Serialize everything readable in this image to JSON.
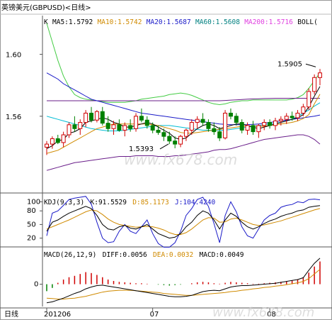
{
  "window": {
    "title": "英镑美元(GBPUSD)<日线>"
  },
  "main_panel": {
    "label": "K",
    "indicators": [
      {
        "text": "MA5:1.5792",
        "color": "#000000"
      },
      {
        "text": "MA10:1.5742",
        "color": "#d08a00"
      },
      {
        "text": "MA20:1.5687",
        "color": "#1a1ac8"
      },
      {
        "text": "MA60:1.5608",
        "color": "#008080"
      },
      {
        "text": "MA200:1.5716",
        "color": "#e040e0"
      },
      {
        "text": "BOLL(",
        "color": "#000000"
      }
    ],
    "y_ticks": [
      "1.60",
      "1.56"
    ],
    "annotations": {
      "high": "1.5905",
      "low": "1.5393"
    }
  },
  "kdj_panel": {
    "label": "KDJ(9,3,3)",
    "values": [
      {
        "text": "K:91.5529",
        "color": "#000000"
      },
      {
        "text": "D:85.1173",
        "color": "#d08a00"
      },
      {
        "text": "J:104.4240",
        "color": "#1a1ac8"
      }
    ],
    "y_ticks": [
      "100",
      "80",
      "50",
      "20"
    ]
  },
  "macd_panel": {
    "label": "MACD(26,12,9)",
    "values": [
      {
        "text": "DIFF:0.0056",
        "color": "#000000"
      },
      {
        "text": "DEA:0.0032",
        "color": "#d08a00"
      },
      {
        "text": "MACD:0.0049",
        "color": "#000000"
      }
    ],
    "y_ticks": [
      "0"
    ]
  },
  "x_axis": {
    "period_label": "日线",
    "ticks": [
      "201206",
      "07",
      "08"
    ]
  },
  "watermark": "www.fx678.com",
  "colors": {
    "up": "#d00000",
    "down": "#008000",
    "k": "#000000",
    "d": "#d08a00",
    "j": "#1a1ac8"
  },
  "chart_data": {
    "type": "candlestick",
    "series": [
      {
        "type": "candlestick",
        "values": [
          [
            1.54,
            1.544,
            1.535,
            1.542
          ],
          [
            1.542,
            1.547,
            1.539,
            1.5455
          ],
          [
            1.5455,
            1.548,
            1.542,
            1.543
          ],
          [
            1.543,
            1.55,
            1.54,
            1.548
          ],
          [
            1.548,
            1.556,
            1.546,
            1.5545
          ],
          [
            1.5545,
            1.56,
            1.55,
            1.552
          ],
          [
            1.552,
            1.558,
            1.548,
            1.556
          ],
          [
            1.556,
            1.564,
            1.553,
            1.562
          ],
          [
            1.562,
            1.566,
            1.556,
            1.5575
          ],
          [
            1.5575,
            1.564,
            1.556,
            1.563
          ],
          [
            1.563,
            1.566,
            1.554,
            1.5555
          ],
          [
            1.5555,
            1.56,
            1.55,
            1.552
          ],
          [
            1.552,
            1.557,
            1.548,
            1.5545
          ],
          [
            1.5545,
            1.558,
            1.55,
            1.551
          ],
          [
            1.551,
            1.556,
            1.547,
            1.554
          ],
          [
            1.554,
            1.558,
            1.55,
            1.552
          ],
          [
            1.552,
            1.562,
            1.55,
            1.56
          ],
          [
            1.56,
            1.565,
            1.556,
            1.5575
          ],
          [
            1.5575,
            1.56,
            1.552,
            1.554
          ],
          [
            1.554,
            1.556,
            1.549,
            1.551
          ],
          [
            1.551,
            1.554,
            1.548,
            1.5495
          ],
          [
            1.5495,
            1.552,
            1.544,
            1.547
          ],
          [
            1.547,
            1.55,
            1.542,
            1.544
          ],
          [
            1.544,
            1.547,
            1.5393,
            1.542
          ],
          [
            1.542,
            1.548,
            1.54,
            1.547
          ],
          [
            1.547,
            1.552,
            1.544,
            1.551
          ],
          [
            1.551,
            1.558,
            1.548,
            1.556
          ],
          [
            1.556,
            1.56,
            1.552,
            1.558
          ],
          [
            1.558,
            1.562,
            1.554,
            1.556
          ],
          [
            1.556,
            1.558,
            1.55,
            1.552
          ],
          [
            1.552,
            1.556,
            1.548,
            1.55
          ],
          [
            1.55,
            1.553,
            1.544,
            1.546
          ],
          [
            1.546,
            1.564,
            1.545,
            1.562
          ],
          [
            1.562,
            1.565,
            1.558,
            1.56
          ],
          [
            1.56,
            1.562,
            1.554,
            1.556
          ],
          [
            1.556,
            1.558,
            1.549,
            1.551
          ],
          [
            1.551,
            1.556,
            1.548,
            1.554
          ],
          [
            1.554,
            1.557,
            1.548,
            1.55
          ],
          [
            1.55,
            1.555,
            1.546,
            1.554
          ],
          [
            1.554,
            1.558,
            1.551,
            1.556
          ],
          [
            1.556,
            1.558,
            1.552,
            1.554
          ],
          [
            1.554,
            1.559,
            1.551,
            1.557
          ],
          [
            1.557,
            1.56,
            1.554,
            1.558
          ],
          [
            1.558,
            1.562,
            1.555,
            1.56
          ],
          [
            1.56,
            1.563,
            1.557,
            1.559
          ],
          [
            1.559,
            1.564,
            1.557,
            1.562
          ],
          [
            1.562,
            1.568,
            1.56,
            1.566
          ],
          [
            1.566,
            1.578,
            1.564,
            1.576
          ],
          [
            1.576,
            1.587,
            1.574,
            1.585
          ],
          [
            1.585,
            1.5905,
            1.58,
            1.588
          ]
        ]
      },
      {
        "name": "MA5",
        "values": [
          1.539,
          1.541,
          1.544,
          1.545,
          1.549,
          1.55,
          1.552,
          1.556,
          1.557,
          1.558,
          1.559,
          1.558,
          1.556,
          1.555,
          1.553,
          1.553,
          1.554,
          1.555,
          1.556,
          1.555,
          1.553,
          1.551,
          1.549,
          1.546,
          1.545,
          1.546,
          1.549,
          1.552,
          1.554,
          1.555,
          1.554,
          1.552,
          1.553,
          1.554,
          1.555,
          1.555,
          1.554,
          1.553,
          1.552,
          1.553,
          1.554,
          1.555,
          1.556,
          1.557,
          1.558,
          1.559,
          1.561,
          1.566,
          1.573,
          1.5792
        ]
      },
      {
        "name": "MA10",
        "values": [
          1.536,
          1.537,
          1.538,
          1.54,
          1.542,
          1.544,
          1.546,
          1.548,
          1.55,
          1.552,
          1.553,
          1.554,
          1.555,
          1.555,
          1.555,
          1.555,
          1.555,
          1.555,
          1.555,
          1.5545,
          1.554,
          1.553,
          1.552,
          1.551,
          1.5495,
          1.549,
          1.549,
          1.5495,
          1.55,
          1.5505,
          1.551,
          1.5515,
          1.552,
          1.5525,
          1.553,
          1.5535,
          1.5535,
          1.5535,
          1.5535,
          1.5535,
          1.554,
          1.5545,
          1.555,
          1.5555,
          1.556,
          1.557,
          1.5585,
          1.561,
          1.568,
          1.5742
        ]
      },
      {
        "name": "MA20",
        "values": [
          1.56,
          1.559,
          1.558,
          1.557,
          1.556,
          1.555,
          1.554,
          1.553,
          1.552,
          1.5515,
          1.551,
          1.5505,
          1.5505,
          1.5505,
          1.551,
          1.5515,
          1.552,
          1.5525,
          1.553,
          1.5535,
          1.554,
          1.554,
          1.554,
          1.5535,
          1.553,
          1.5525,
          1.552,
          1.5515,
          1.551,
          1.551,
          1.551,
          1.551,
          1.551,
          1.5515,
          1.552,
          1.5525,
          1.553,
          1.5535,
          1.554,
          1.5545,
          1.555,
          1.5555,
          1.556,
          1.557,
          1.558,
          1.56,
          1.562,
          1.564,
          1.5665,
          1.5687
        ]
      },
      {
        "name": "MA60",
        "values": [
          1.588,
          1.586,
          1.584,
          1.581,
          1.579,
          1.577,
          1.575,
          1.573,
          1.571,
          1.57,
          1.569,
          1.568,
          1.567,
          1.566,
          1.565,
          1.564,
          1.563,
          1.562,
          1.5615,
          1.561,
          1.5605,
          1.56,
          1.5595,
          1.559,
          1.5585,
          1.558,
          1.5575,
          1.557,
          1.5565,
          1.556,
          1.5555,
          1.555,
          1.5548,
          1.5546,
          1.5545,
          1.5545,
          1.5546,
          1.5548,
          1.555,
          1.5555,
          1.556,
          1.5565,
          1.557,
          1.5575,
          1.558,
          1.5585,
          1.559,
          1.5595,
          1.56,
          1.5608
        ]
      },
      {
        "name": "MA200",
        "values": [
          1.57,
          1.57,
          1.57,
          1.57,
          1.57,
          1.57,
          1.57,
          1.57,
          1.57,
          1.57,
          1.57,
          1.57,
          1.57,
          1.57,
          1.57,
          1.57,
          1.57,
          1.57,
          1.57,
          1.57,
          1.57,
          1.57,
          1.57,
          1.57,
          1.57,
          1.57,
          1.57,
          1.57,
          1.57,
          1.57,
          1.57,
          1.57,
          1.5702,
          1.5704,
          1.5706,
          1.5708,
          1.571,
          1.5712,
          1.5713,
          1.5714,
          1.5715,
          1.5716,
          1.5716,
          1.5716,
          1.5716,
          1.5716,
          1.5716,
          1.5716,
          1.5716,
          1.5716
        ]
      },
      {
        "name": "BOLL-UP",
        "values": [
          1.62,
          1.608,
          1.596,
          1.586,
          1.579,
          1.574,
          1.572,
          1.571,
          1.5705,
          1.57,
          1.5695,
          1.569,
          1.569,
          1.569,
          1.569,
          1.5695,
          1.57,
          1.571,
          1.5715,
          1.572,
          1.5725,
          1.573,
          1.574,
          1.5745,
          1.575,
          1.5745,
          1.5735,
          1.572,
          1.5705,
          1.569,
          1.568,
          1.5675,
          1.568,
          1.569,
          1.5695,
          1.57,
          1.57,
          1.5705,
          1.5705,
          1.5705,
          1.5705,
          1.5705,
          1.5705,
          1.5705,
          1.571,
          1.572,
          1.574,
          1.578,
          1.583,
          1.588
        ]
      },
      {
        "name": "BOLL-LOW",
        "values": [
          1.525,
          1.526,
          1.527,
          1.528,
          1.529,
          1.53,
          1.5305,
          1.531,
          1.5315,
          1.532,
          1.5325,
          1.533,
          1.5335,
          1.534,
          1.534,
          1.534,
          1.5345,
          1.5345,
          1.5345,
          1.5345,
          1.534,
          1.534,
          1.534,
          1.5345,
          1.5345,
          1.535,
          1.5355,
          1.536,
          1.5365,
          1.537,
          1.538,
          1.5385,
          1.5385,
          1.539,
          1.54,
          1.541,
          1.542,
          1.543,
          1.544,
          1.545,
          1.5455,
          1.546,
          1.5465,
          1.547,
          1.5475,
          1.548,
          1.548,
          1.547,
          1.545,
          1.542
        ]
      },
      {
        "name": "K",
        "values": [
          35,
          55,
          60,
          68,
          75,
          80,
          85,
          90,
          85,
          70,
          50,
          40,
          38,
          45,
          48,
          42,
          40,
          45,
          50,
          40,
          30,
          25,
          20,
          22,
          30,
          45,
          55,
          70,
          80,
          75,
          60,
          40,
          60,
          75,
          68,
          55,
          45,
          40,
          45,
          52,
          58,
          62,
          68,
          72,
          75,
          80,
          82,
          88,
          90,
          91.55
        ]
      },
      {
        "name": "D",
        "values": [
          40,
          45,
          50,
          55,
          60,
          66,
          72,
          78,
          82,
          80,
          72,
          62,
          55,
          50,
          48,
          46,
          44,
          45,
          46,
          45,
          42,
          38,
          32,
          28,
          28,
          32,
          40,
          50,
          60,
          65,
          64,
          55,
          56,
          62,
          64,
          60,
          55,
          50,
          48,
          49,
          52,
          55,
          58,
          62,
          66,
          70,
          74,
          78,
          82,
          85.12
        ]
      },
      {
        "name": "J",
        "values": [
          25,
          75,
          80,
          92,
          105,
          108,
          110,
          112,
          95,
          55,
          20,
          10,
          12,
          35,
          50,
          35,
          30,
          45,
          60,
          30,
          8,
          0,
          0,
          10,
          35,
          70,
          85,
          105,
          110,
          90,
          52,
          10,
          70,
          100,
          78,
          45,
          25,
          20,
          40,
          60,
          70,
          75,
          88,
          92,
          94,
          100,
          98,
          105,
          106,
          104.42
        ]
      },
      {
        "name": "MACD",
        "values": [
          -0.0015,
          -0.0008,
          0.0003,
          0.001,
          0.0015,
          0.0018,
          0.0022,
          0.0026,
          0.0024,
          0.002,
          0.0015,
          0.001,
          0.0007,
          0.0005,
          0.0004,
          0.0003,
          0.0002,
          0.0002,
          0.0001,
          0.0,
          -0.0001,
          -0.0002,
          -0.0003,
          -0.0002,
          -0.0001,
          0.0,
          0.0002,
          0.0004,
          0.0005,
          0.0004,
          0.0002,
          0.0001,
          0.0003,
          0.0005,
          0.0004,
          0.0003,
          0.0002,
          0.0001,
          0.0001,
          0.0002,
          0.0003,
          0.0004,
          0.0005,
          0.0006,
          0.0008,
          0.001,
          0.0015,
          0.0025,
          0.0038,
          0.0049
        ]
      },
      {
        "name": "DIFF",
        "values": [
          -0.004,
          -0.0038,
          -0.0034,
          -0.003,
          -0.0025,
          -0.002,
          -0.0016,
          -0.001,
          -0.0006,
          -0.0003,
          -0.0002,
          -0.0004,
          -0.0006,
          -0.0008,
          -0.001,
          -0.0012,
          -0.0014,
          -0.0016,
          -0.0018,
          -0.002,
          -0.0022,
          -0.0024,
          -0.0026,
          -0.0027,
          -0.0027,
          -0.0026,
          -0.0024,
          -0.002,
          -0.0016,
          -0.0014,
          -0.0013,
          -0.0014,
          -0.001,
          -0.0006,
          -0.0004,
          -0.0003,
          -0.0003,
          -0.0002,
          -0.0001,
          0.0,
          0.0001,
          0.0002,
          0.0004,
          0.0006,
          0.0008,
          0.001,
          0.0014,
          0.003,
          0.0045,
          0.0056
        ]
      },
      {
        "name": "DEA",
        "values": [
          -0.003,
          -0.0031,
          -0.0032,
          -0.0032,
          -0.0031,
          -0.003,
          -0.0028,
          -0.0026,
          -0.0023,
          -0.002,
          -0.0017,
          -0.0015,
          -0.0014,
          -0.0013,
          -0.0013,
          -0.0013,
          -0.0014,
          -0.0015,
          -0.0016,
          -0.0017,
          -0.0018,
          -0.002,
          -0.0021,
          -0.0022,
          -0.0023,
          -0.0024,
          -0.0024,
          -0.0023,
          -0.0022,
          -0.0021,
          -0.002,
          -0.0019,
          -0.0018,
          -0.0016,
          -0.0015,
          -0.0013,
          -0.0012,
          -0.001,
          -0.0009,
          -0.0007,
          -0.0006,
          -0.0004,
          -0.0003,
          -0.0001,
          0.0001,
          0.0003,
          0.0006,
          0.0012,
          0.0022,
          0.0032
        ]
      }
    ]
  }
}
